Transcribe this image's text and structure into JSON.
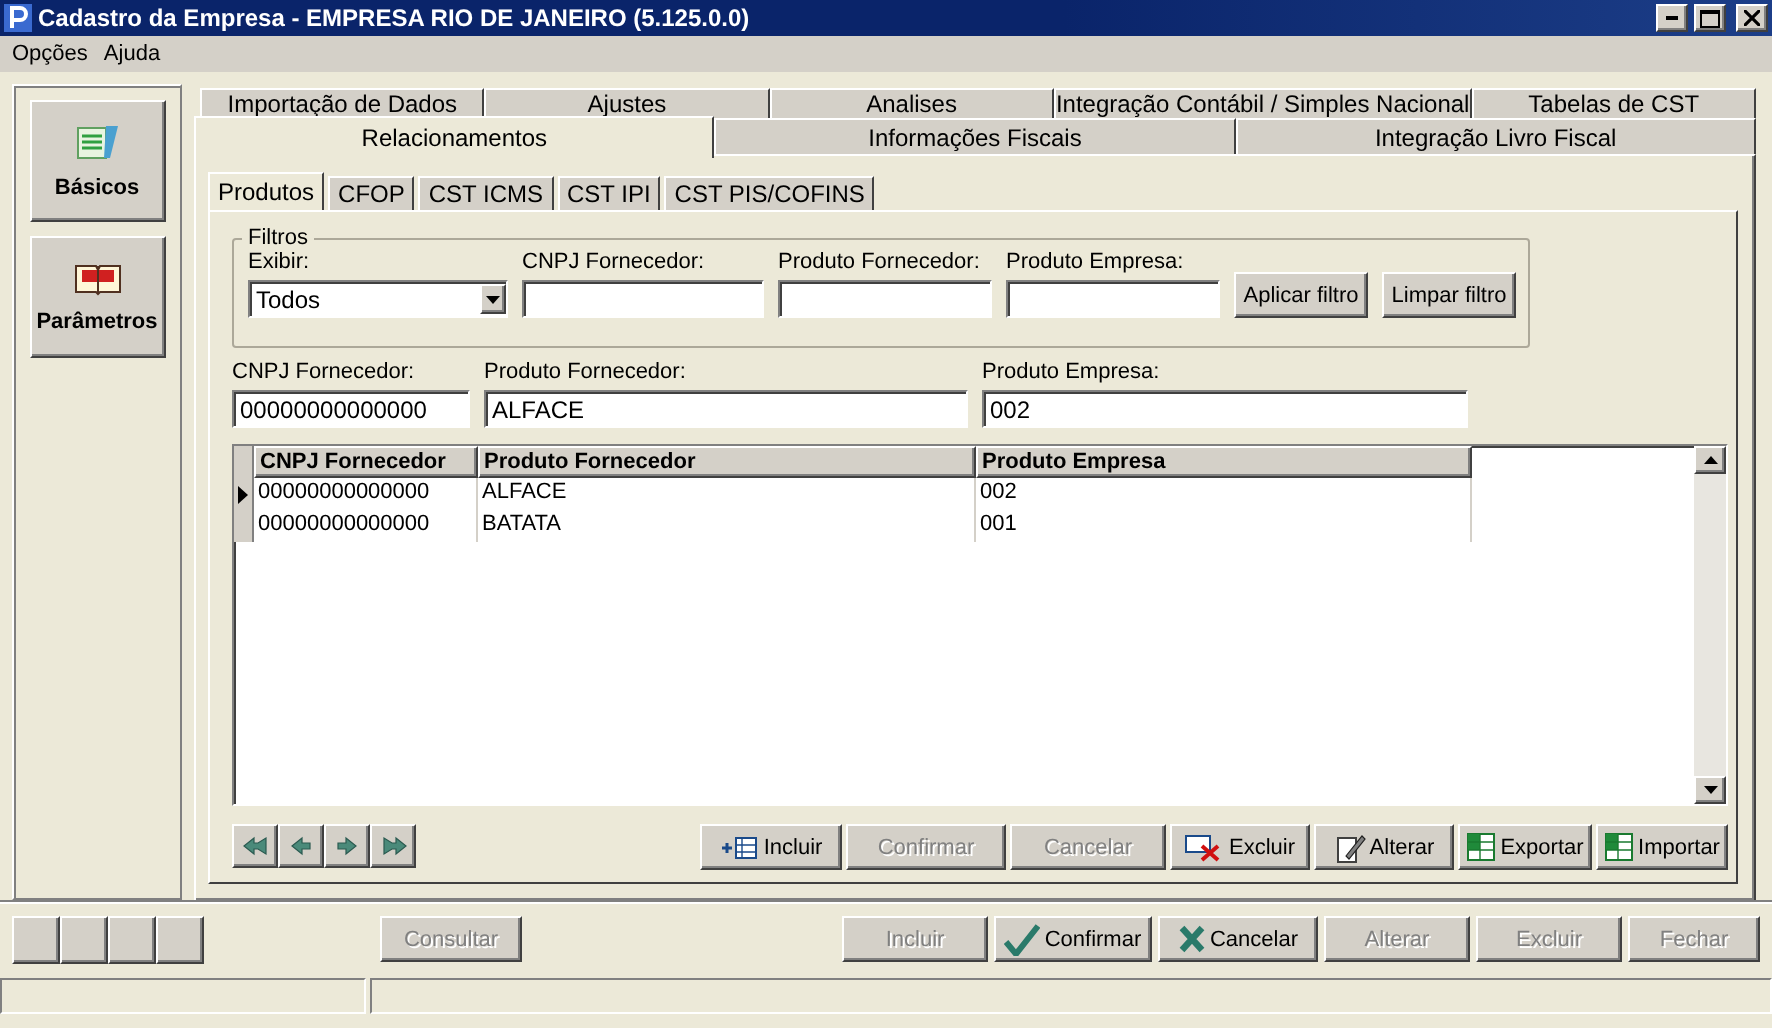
{
  "window": {
    "title": "Cadastro da Empresa - EMPRESA RIO DE JANEIRO (5.125.0.0)"
  },
  "menu": [
    "Opções",
    "Ajuda"
  ],
  "side_buttons": [
    {
      "label": "Básicos"
    },
    {
      "label": "Parâmetros"
    }
  ],
  "tab_rows": [
    {
      "tabs": [
        {
          "label": "Importação de Dados",
          "selected": false
        },
        {
          "label": "Ajustes",
          "selected": false
        },
        {
          "label": "Analises",
          "selected": false
        },
        {
          "label": "Integração Contábil / Simples Nacional",
          "selected": false
        },
        {
          "label": "Tabelas de CST",
          "selected": false
        }
      ]
    },
    {
      "tabs": [
        {
          "label": "Relacionamentos",
          "selected": true
        },
        {
          "label": "Informações Fiscais",
          "selected": false
        },
        {
          "label": "Integração Livro Fiscal",
          "selected": false
        }
      ]
    }
  ],
  "subtabs": [
    {
      "label": "Produtos",
      "selected": true
    },
    {
      "label": "CFOP",
      "selected": false
    },
    {
      "label": "CST ICMS",
      "selected": false
    },
    {
      "label": "CST IPI",
      "selected": false
    },
    {
      "label": "CST PIS/COFINS",
      "selected": false
    }
  ],
  "filters": {
    "title": "Filtros",
    "fields": [
      {
        "kind": "select",
        "label": "Exibir:",
        "value": "Todos"
      },
      {
        "kind": "text",
        "label": "CNPJ Fornecedor:"
      },
      {
        "kind": "text",
        "label": "Produto Fornecedor:"
      },
      {
        "kind": "text",
        "label": "Produto Empresa:"
      }
    ],
    "buttons": [
      "Aplicar filtro",
      "Limpar filtro"
    ]
  },
  "record": [
    {
      "label": "CNPJ Fornecedor:",
      "value": "00000000000000"
    },
    {
      "label": "Produto Fornecedor:",
      "value": "ALFACE"
    },
    {
      "label": "Produto Empresa:",
      "value": "002"
    }
  ],
  "grid": {
    "columns": [
      "CNPJ Fornecedor",
      "Produto Fornecedor",
      "Produto Empresa"
    ],
    "rows": [
      {
        "selected": true,
        "cells": [
          "00000000000000",
          "ALFACE",
          "002"
        ]
      },
      {
        "selected": false,
        "cells": [
          "00000000000000",
          "BATATA",
          "001"
        ]
      }
    ]
  },
  "nav_buttons": [
    {
      "kind": "first"
    },
    {
      "kind": "prev"
    },
    {
      "kind": "next"
    },
    {
      "kind": "last"
    }
  ],
  "grid_actions": [
    {
      "label": "Incluir",
      "disabled": false
    },
    {
      "label": "Confirmar",
      "disabled": true
    },
    {
      "label": "Cancelar",
      "disabled": true
    },
    {
      "label": "Excluir",
      "disabled": false
    },
    {
      "label": "Alterar",
      "disabled": false
    },
    {
      "label": "Exportar",
      "disabled": false
    },
    {
      "label": "Importar",
      "disabled": false
    }
  ],
  "bottom_actions": [
    {
      "label": "Consultar",
      "disabled": true
    },
    {
      "label": "Incluir",
      "disabled": true
    },
    {
      "label": "Confirmar",
      "disabled": false
    },
    {
      "label": "Cancelar",
      "disabled": false
    },
    {
      "label": "Alterar",
      "disabled": true
    },
    {
      "label": "Excluir",
      "disabled": true
    },
    {
      "label": "Fechar",
      "disabled": true
    }
  ]
}
